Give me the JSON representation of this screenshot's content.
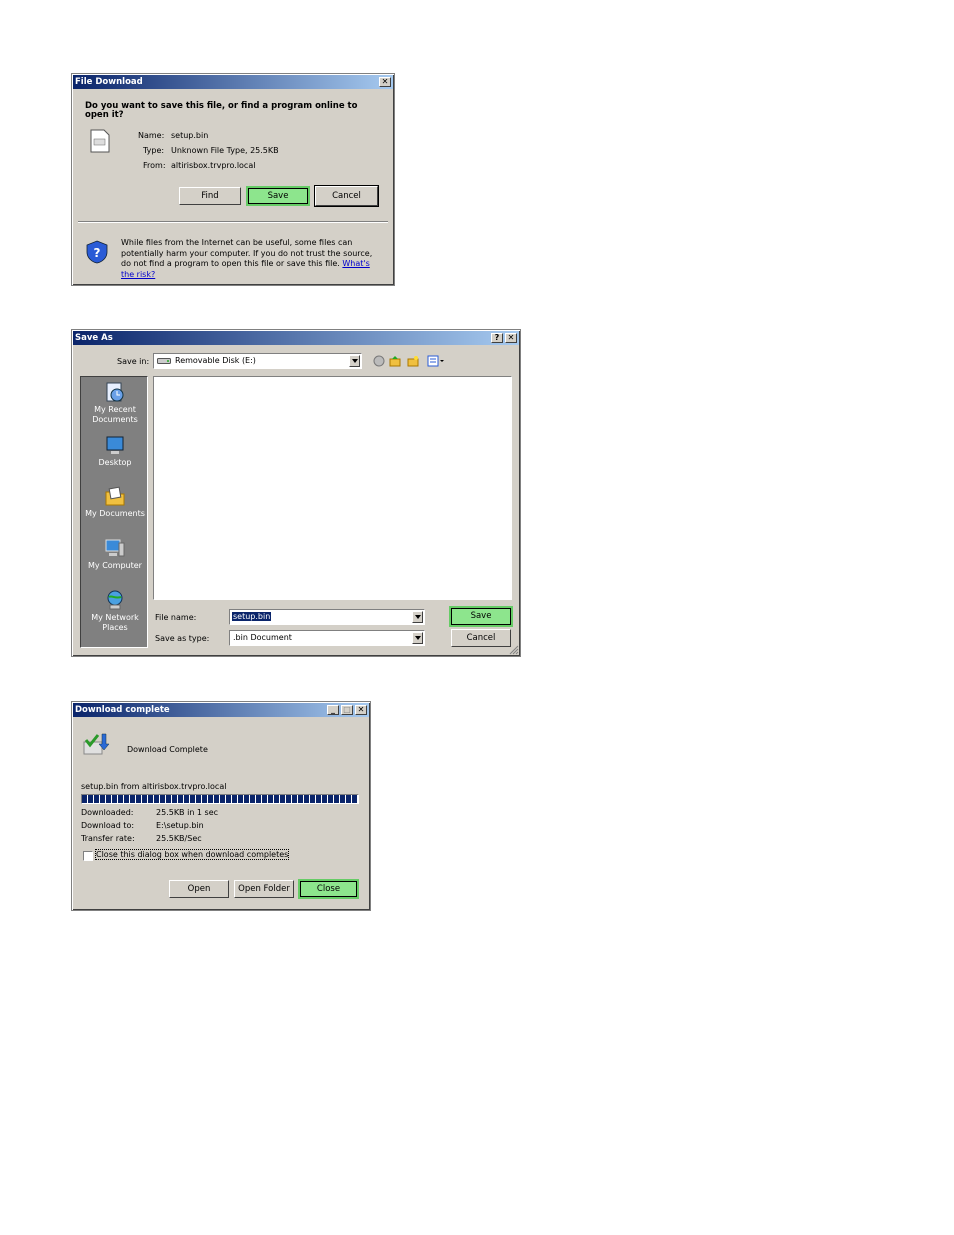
{
  "file_download": {
    "title": "File Download",
    "question": "Do you want to save this file, or find a program online to open it?",
    "name_label": "Name:",
    "name_value": "setup.bin",
    "type_label": "Type:",
    "type_value": "Unknown File Type, 25.5KB",
    "from_label": "From:",
    "from_value": "altirisbox.trvpro.local",
    "find_button": "Find",
    "save_button": "Save",
    "cancel_button": "Cancel",
    "warning_text": "While files from the Internet can be useful, some files can potentially harm your computer. If you do not trust the source, do not find a program to open this file or save this file.",
    "risk_link": "What's the risk?",
    "close_glyph": "✕"
  },
  "save_as": {
    "title": "Save As",
    "save_in_label": "Save in:",
    "save_in_value": "Removable Disk (E:)",
    "places": [
      "My Recent Documents",
      "Desktop",
      "My Documents",
      "My Computer",
      "My Network Places"
    ],
    "file_name_label": "File name:",
    "file_name_value": "setup.bin",
    "save_as_type_label": "Save as type:",
    "save_as_type_value": ".bin Document",
    "save_button": "Save",
    "cancel_button": "Cancel",
    "help_glyph": "?",
    "close_glyph": "✕"
  },
  "download_complete": {
    "title": "Download complete",
    "heading": "Download Complete",
    "source": "setup.bin from altirisbox.trvpro.local",
    "progress_percent": 100,
    "downloaded_label": "Downloaded:",
    "downloaded_value": "25.5KB in 1 sec",
    "download_to_label": "Download to:",
    "download_to_value": "E:\\setup.bin",
    "transfer_rate_label": "Transfer rate:",
    "transfer_rate_value": "25.5KB/Sec",
    "close_checkbox_label": "Close this dialog box when download completes",
    "open_button": "Open",
    "open_folder_button": "Open Folder",
    "close_button": "Close",
    "minimize_glyph": "_",
    "maximize_glyph": "□",
    "close_glyph": "✕"
  }
}
